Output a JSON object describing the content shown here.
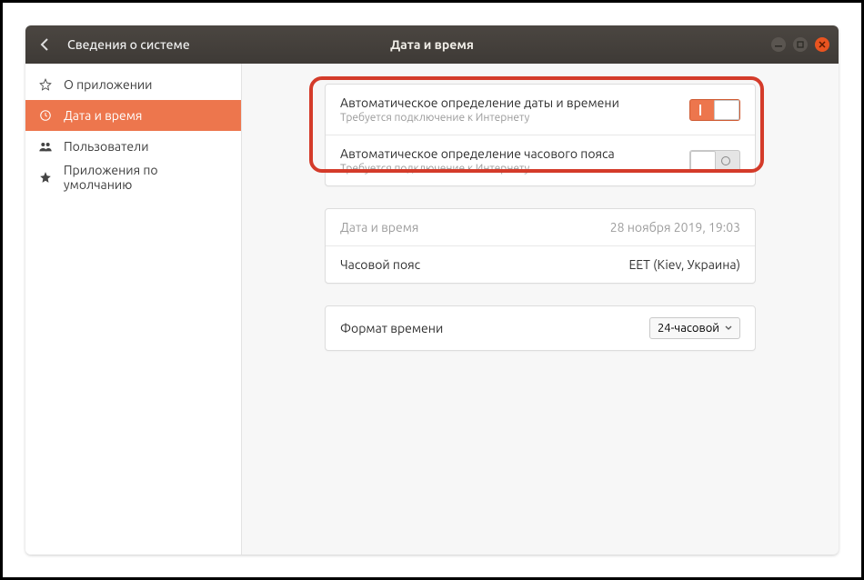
{
  "titlebar": {
    "back_label": "Сведения о системе",
    "title": "Дата и время"
  },
  "sidebar": {
    "items": [
      {
        "label": "О приложении",
        "icon": "star-outline-icon"
      },
      {
        "label": "Дата и время",
        "icon": "clock-icon"
      },
      {
        "label": "Пользователи",
        "icon": "users-icon"
      },
      {
        "label": "Приложения по умолчанию",
        "icon": "star-icon"
      }
    ],
    "active_index": 1
  },
  "settings": {
    "auto_datetime": {
      "title": "Автоматическое определение даты и времени",
      "subtitle": "Требуется подключение к Интернету",
      "on": true
    },
    "auto_timezone": {
      "title": "Автоматическое определение часового пояса",
      "subtitle": "Требуется подключение к Интернету",
      "on": false
    },
    "datetime_row": {
      "label": "Дата и время",
      "value": "28 ноября 2019, 19:03"
    },
    "timezone_row": {
      "label": "Часовой пояс",
      "value": "EET (Kiev, Украина)"
    },
    "format_row": {
      "label": "Формат времени",
      "value": "24-часовой"
    }
  },
  "colors": {
    "accent": "#ed764d",
    "callout": "#d43b2a"
  }
}
